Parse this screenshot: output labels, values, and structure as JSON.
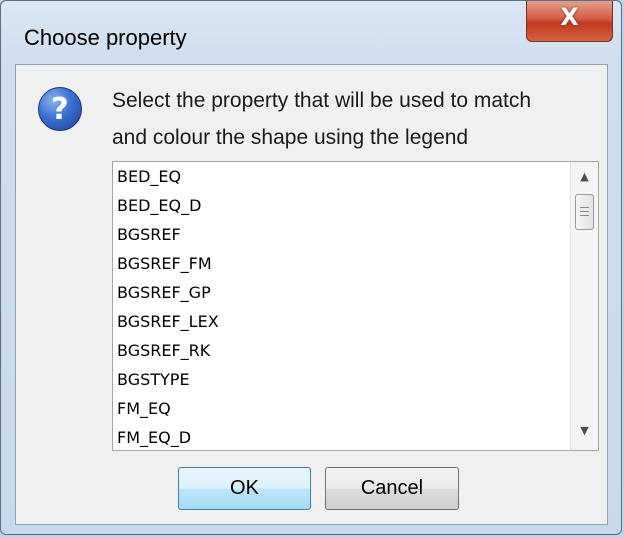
{
  "dialog": {
    "title": "Choose property",
    "close_label": "X",
    "icon": "question-icon",
    "message_line1": "Select the property that will be used to match",
    "message_line2": "and colour the shape using the legend"
  },
  "list": {
    "items": [
      "BED_EQ",
      "BED_EQ_D",
      "BGSREF",
      "BGSREF_FM",
      "BGSREF_GP",
      "BGSREF_LEX",
      "BGSREF_RK",
      "BGSTYPE",
      "FM_EQ",
      "FM_EQ_D"
    ],
    "scroll_up": "▲",
    "scroll_down": "▼"
  },
  "buttons": {
    "ok_label": "OK",
    "cancel_label": "Cancel"
  }
}
